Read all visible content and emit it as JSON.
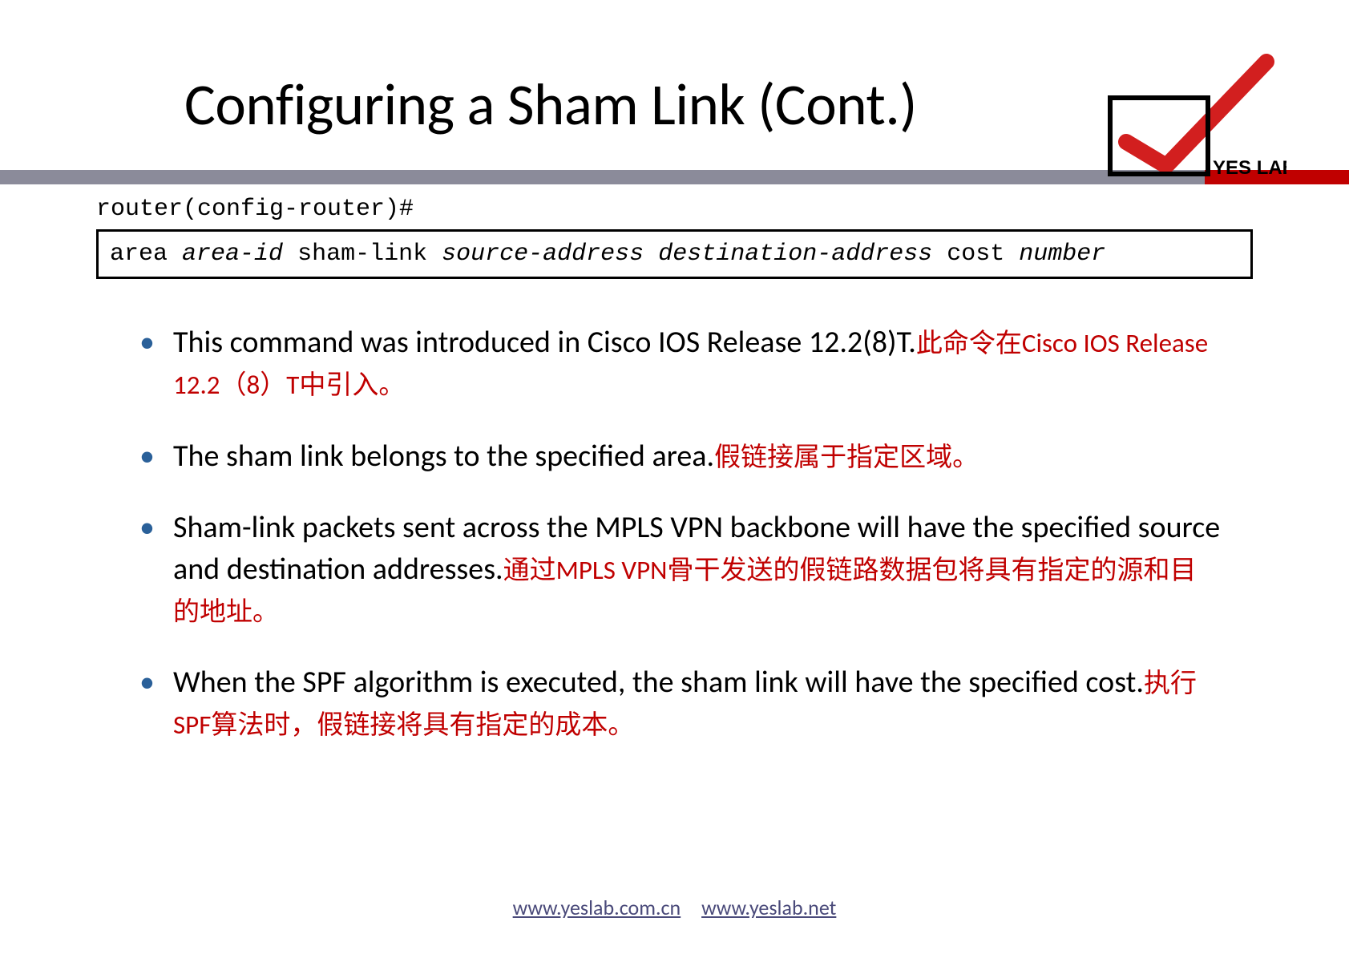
{
  "title": "Configuring a Sham Link (Cont.)",
  "logo_text": "YES LAB",
  "prompt": "router(config-router)#",
  "command": {
    "kw1": "area",
    "arg1": "area-id",
    "kw2": "sham-link",
    "arg2": "source-address",
    "arg3": "destination-address",
    "kw3": "cost",
    "arg4": "number"
  },
  "bullets": [
    {
      "en": "This command was introduced in Cisco IOS Release 12.2(8)T.",
      "zh": "此命令在Cisco IOS Release 12.2（8）T中引入。"
    },
    {
      "en": "The sham link belongs to the specified area.",
      "zh": "假链接属于指定区域。"
    },
    {
      "en": "Sham-link packets sent across the MPLS VPN backbone will have the specified source and destination addresses.",
      "zh": "通过MPLS VPN骨干发送的假链路数据包将具有指定的源和目的地址。"
    },
    {
      "en": "When the SPF algorithm is executed, the sham link will have the specified cost.",
      "zh": "执行SPF算法时，假链接将具有指定的成本。"
    }
  ],
  "footer": {
    "link1": "www.yeslab.com.cn",
    "link2": "www.yeslab.net"
  }
}
